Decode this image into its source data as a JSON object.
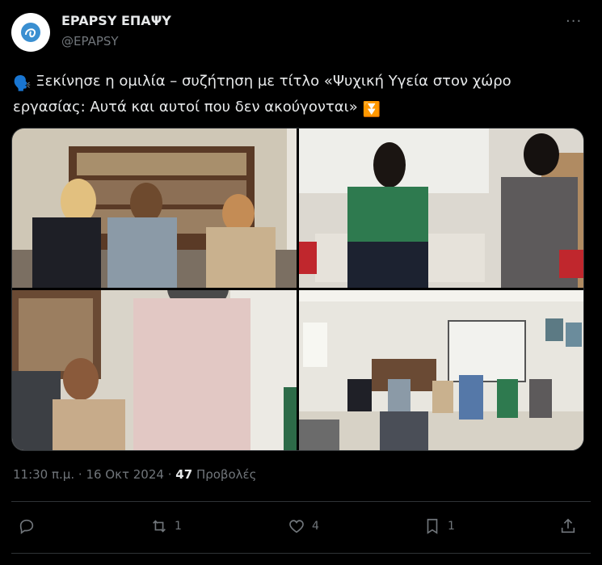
{
  "author": {
    "name": "EPAPSY ΕΠΑΨΥ",
    "handle": "@EPAPSY"
  },
  "more_label": "···",
  "tweet": {
    "emoji_start": "🗣️",
    "text": "Ξεκίνησε η ομιλία – συζήτηση με τίτλο «Ψυχική Υγεία στον χώρο εργασίας: Αυτά και αυτοί που δεν ακούγονται»",
    "emoji_end": "⏬"
  },
  "meta": {
    "time": "11:30 π.μ.",
    "separator": "·",
    "date": "16 Οκτ 2024",
    "views_count": "47",
    "views_label": "Προβολές"
  },
  "actions": {
    "reply_count": "",
    "retweet_count": "1",
    "like_count": "4",
    "bookmark_count": "1"
  },
  "colors": {
    "background": "#000000",
    "text": "#e7e9ea",
    "muted": "#71767b",
    "border": "#2f3336"
  }
}
